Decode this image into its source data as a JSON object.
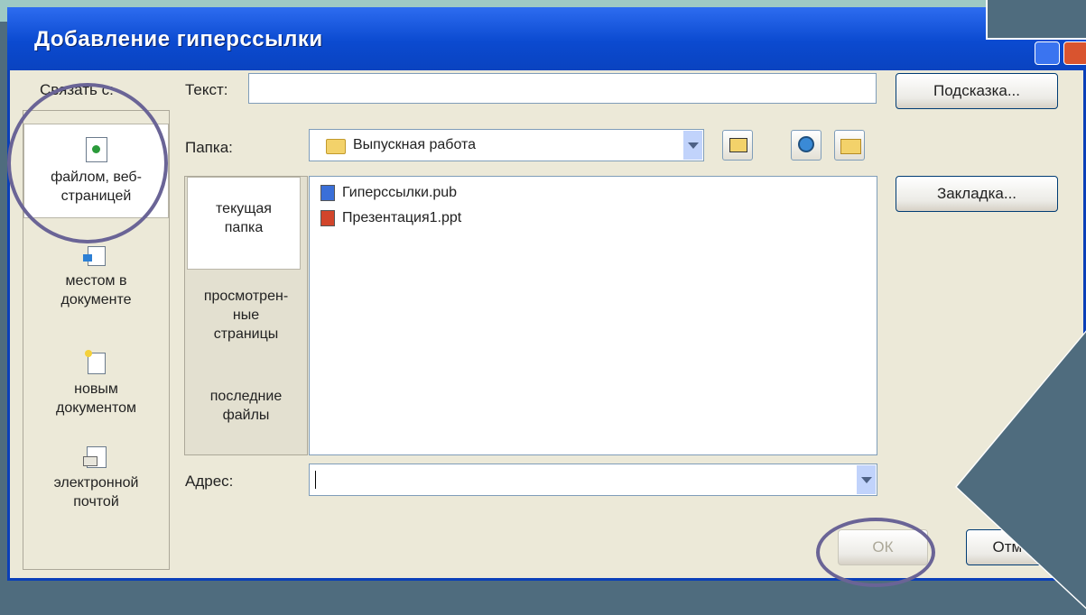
{
  "dialog": {
    "title": "Добавление гиперссылки",
    "link_to_label": "Связать с:",
    "text_label": "Текст:",
    "text_value": "",
    "tooltip_button": "Подсказка...",
    "folder_label": "Папка:",
    "folder_value": "Выпускная работа",
    "bookmark_button": "Закладка...",
    "address_label": "Адрес:",
    "address_value": "",
    "ok_button": "ОК",
    "cancel_button": "Отмена"
  },
  "link_targets": [
    {
      "label": "файлом, веб-\nстраницей",
      "icon": "web-page-icon",
      "active": true
    },
    {
      "label": "местом в\nдокументе",
      "icon": "document-place-icon",
      "active": false
    },
    {
      "label": "новым\nдокументом",
      "icon": "new-document-icon",
      "active": false
    },
    {
      "label": "электронной\nпочтой",
      "icon": "email-icon",
      "active": false
    }
  ],
  "look_in": [
    {
      "label": "текущая\nпапка",
      "active": true
    },
    {
      "label": "просмотрен-\nные\nстраницы",
      "active": false
    },
    {
      "label": "последние\nфайлы",
      "active": false
    }
  ],
  "files": [
    {
      "name": "Гиперссылки.pub",
      "icon": "publisher-file-icon",
      "color": "#3a6fd8"
    },
    {
      "name": "Презентация1.ppt",
      "icon": "powerpoint-file-icon",
      "color": "#d2452b"
    }
  ],
  "colors": {
    "titlebar": "#0b4ad0",
    "dialog_bg": "#ece9d8",
    "backdrop": "#4f6c7e",
    "highlight_circle": "#6a6496"
  }
}
